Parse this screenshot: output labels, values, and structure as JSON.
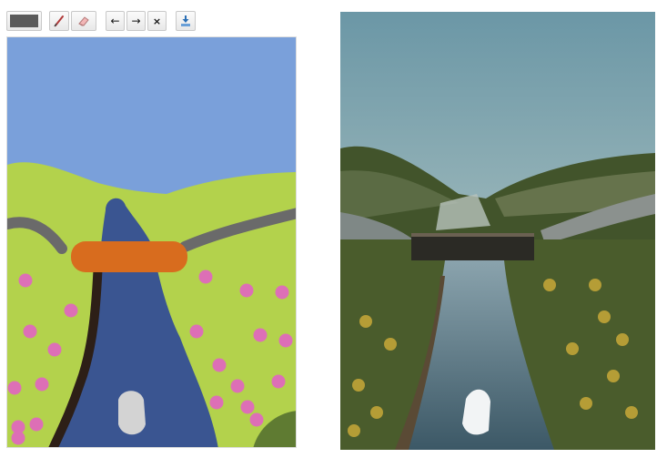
{
  "toolbar": {
    "active_color": "#5b5b5b",
    "tools": [
      {
        "name": "brush",
        "icon": "brush-icon"
      },
      {
        "name": "eraser",
        "icon": "eraser-icon"
      }
    ],
    "undo_label": "←",
    "redo_label": "→",
    "clear_label": "×",
    "download_icon": "download-icon"
  },
  "palette": {
    "sky": "#7aa0da",
    "grass": "#b3d24c",
    "water": "#3a5591",
    "bridge": "#d86c1e",
    "road": "#6a6a6a",
    "flowers": "#dd6fb6",
    "riverbank": "#2d1f17",
    "rock": "#d3d3d3",
    "bush": "#5f7b32"
  },
  "generated_image": {
    "sky_top": "#6b97a6",
    "sky_bottom": "#c6d3cc",
    "hills": "#42542b",
    "field": "#4a5c2c",
    "river": "#4e6b7a"
  }
}
